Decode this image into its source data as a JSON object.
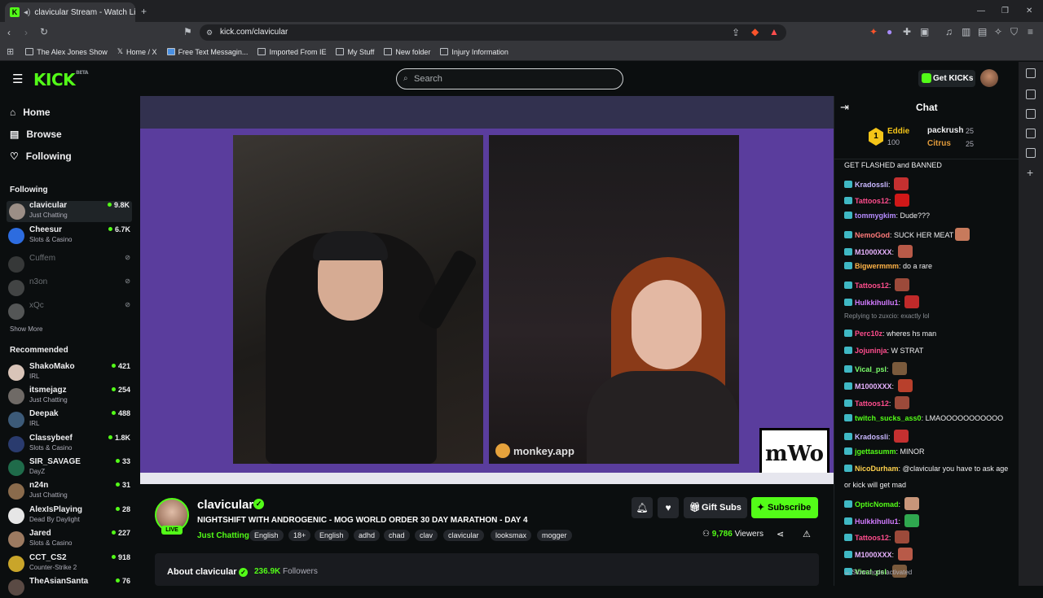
{
  "browser": {
    "tab_title": "clavicular Stream - Watch Live",
    "url": "kick.com/clavicular",
    "bookmarks": [
      "The Alex Jones Show",
      "Home / X",
      "Free Text Messagin...",
      "Imported From IE",
      "My Stuff",
      "New folder",
      "Injury Information"
    ]
  },
  "header": {
    "logo": "KICK",
    "logo_beta": "BETA",
    "search_placeholder": "Search",
    "get_kicks": "Get KICKs"
  },
  "sidebar": {
    "nav": [
      {
        "label": "Home",
        "icon": "home-icon"
      },
      {
        "label": "Browse",
        "icon": "browse-icon"
      },
      {
        "label": "Following",
        "icon": "heart-icon"
      }
    ],
    "following_heading": "Following",
    "following": [
      {
        "name": "clavicular",
        "category": "Just Chatting",
        "viewers": "9.8K",
        "live": true
      },
      {
        "name": "Cheesur",
        "category": "Slots & Casino",
        "viewers": "6.7K",
        "live": true
      },
      {
        "name": "Cuffem",
        "category": "",
        "viewers": "",
        "live": false
      },
      {
        "name": "n3on",
        "category": "",
        "viewers": "",
        "live": false
      },
      {
        "name": "xQc",
        "category": "",
        "viewers": "",
        "live": false
      }
    ],
    "show_more": "Show More",
    "recommended_heading": "Recommended",
    "recommended": [
      {
        "name": "ShakoMako",
        "category": "IRL",
        "viewers": "421"
      },
      {
        "name": "itsmejagz",
        "category": "Just Chatting",
        "viewers": "254"
      },
      {
        "name": "Deepak",
        "category": "IRL",
        "viewers": "488"
      },
      {
        "name": "Classybeef",
        "category": "Slots & Casino",
        "viewers": "1.8K"
      },
      {
        "name": "SIR_SAVAGE",
        "category": "DayZ",
        "viewers": "33"
      },
      {
        "name": "n24n",
        "category": "Just Chatting",
        "viewers": "31"
      },
      {
        "name": "AlexIsPlaying",
        "category": "Dead By Daylight",
        "viewers": "28"
      },
      {
        "name": "Jared",
        "category": "Slots & Casino",
        "viewers": "227"
      },
      {
        "name": "CCT_CS2",
        "category": "Counter-Strike 2",
        "viewers": "918"
      },
      {
        "name": "TheAsianSanta",
        "category": "",
        "viewers": "76"
      }
    ]
  },
  "video": {
    "overlay_label": "monkey.app",
    "logo_text": "mWo"
  },
  "stream": {
    "streamer": "clavicular",
    "live_label": "LIVE",
    "title": "NIGHTSHIFT WITH ANDROGENIC - MOG WORLD ORDER 30 DAY MARATHON - DAY 4",
    "category": "Just Chatting",
    "tags": [
      "English",
      "18+",
      "English",
      "adhd",
      "chad",
      "clav",
      "clavicular",
      "looksmax",
      "mogger"
    ],
    "gift_subs": "Gift Subs",
    "subscribe": "Subscribe",
    "viewers": "9,786",
    "viewers_label": "Viewers",
    "about_title": "About clavicular",
    "followers": "236.9K",
    "followers_label": "Followers"
  },
  "chat": {
    "title": "Chat",
    "pinned_gifters": [
      {
        "rank": "1",
        "name": "Eddie",
        "amount": "100"
      },
      {
        "name": "packrush",
        "amount": "25"
      },
      {
        "name": "Citrus",
        "amount": "25"
      }
    ],
    "messages": [
      {
        "user": "",
        "text": "GET FLASHED and BANNED",
        "color": "#efeff1"
      },
      {
        "user": "Kradossli",
        "text": "",
        "color": "#c9b8ff",
        "emote": "#c43030"
      },
      {
        "user": "Tattoos12",
        "text": "",
        "color": "#ff4d8d",
        "emote": "#d01818"
      },
      {
        "user": "tommygkim",
        "text": "Dude???",
        "color": "#b68cff"
      },
      {
        "user": "NemoGod",
        "text": "SUCK HER MEAT",
        "color": "#ff7a7a",
        "emote": "#c77a5c"
      },
      {
        "user": "M1000XXX",
        "text": "",
        "color": "#e8b3ff",
        "emote": "#b85a48"
      },
      {
        "user": "Bigwermmm",
        "text": "do a rare",
        "color": "#ffb347"
      },
      {
        "user": "Tattoos12",
        "text": "",
        "color": "#ff4d8d",
        "emote": "#9c4a3a"
      },
      {
        "user": "Hulkkihullu1",
        "text": "",
        "color": "#d27bff",
        "emote": "#c02a2a"
      },
      {
        "user": "",
        "text": "Replying to zuxcio: exactly lol",
        "color": "#8a8f95"
      },
      {
        "user": "Perc10z",
        "text": "wheres hs man",
        "color": "#ff4d8d"
      },
      {
        "user": "Jojuninja",
        "text": "W STRAT",
        "color": "#ff4d8d"
      },
      {
        "user": "Vical_psl",
        "text": "",
        "color": "#7cff6b",
        "emote": "#7a5a3c"
      },
      {
        "user": "M1000XXX",
        "text": "",
        "color": "#e8b3ff",
        "emote": "#b8402c"
      },
      {
        "user": "Tattoos12",
        "text": "",
        "color": "#ff4d8d",
        "emote": "#9c4a3a"
      },
      {
        "user": "twitch_sucks_ass0",
        "text": "LMAOOOOOOOOOOO",
        "color": "#53fc18"
      },
      {
        "user": "Kradossli",
        "text": "",
        "color": "#c9b8ff",
        "emote": "#c43030"
      },
      {
        "user": "jgettasumm",
        "text": "MINOR",
        "color": "#53fc18"
      },
      {
        "user": "NicoDurham",
        "text": "@clavicular you have to ask age",
        "color": "#ffd24d"
      },
      {
        "user": "",
        "text": "or kick will get mad",
        "color": "#efeff1"
      },
      {
        "user": "OpticNomad",
        "text": "",
        "color": "#53fc18",
        "emote": "#c8967a"
      },
      {
        "user": "Hulkkihullu1",
        "text": "",
        "color": "#d27bff",
        "emote": "#2fa84f"
      },
      {
        "user": "Tattoos12",
        "text": "",
        "color": "#ff4d8d",
        "emote": "#9c4a3a"
      },
      {
        "user": "M1000XXX",
        "text": "",
        "color": "#e8b3ff",
        "emote": "#b85a48"
      },
      {
        "user": "Vical_psl",
        "text": "",
        "color": "#7cff6b",
        "emote": "#7a5a3c"
      }
    ],
    "slow_mode": "Slow mode activated"
  },
  "colors": {
    "brand": "#53fc18",
    "bg": "#0b0e0f",
    "video_bg": "#5a3d9d"
  }
}
